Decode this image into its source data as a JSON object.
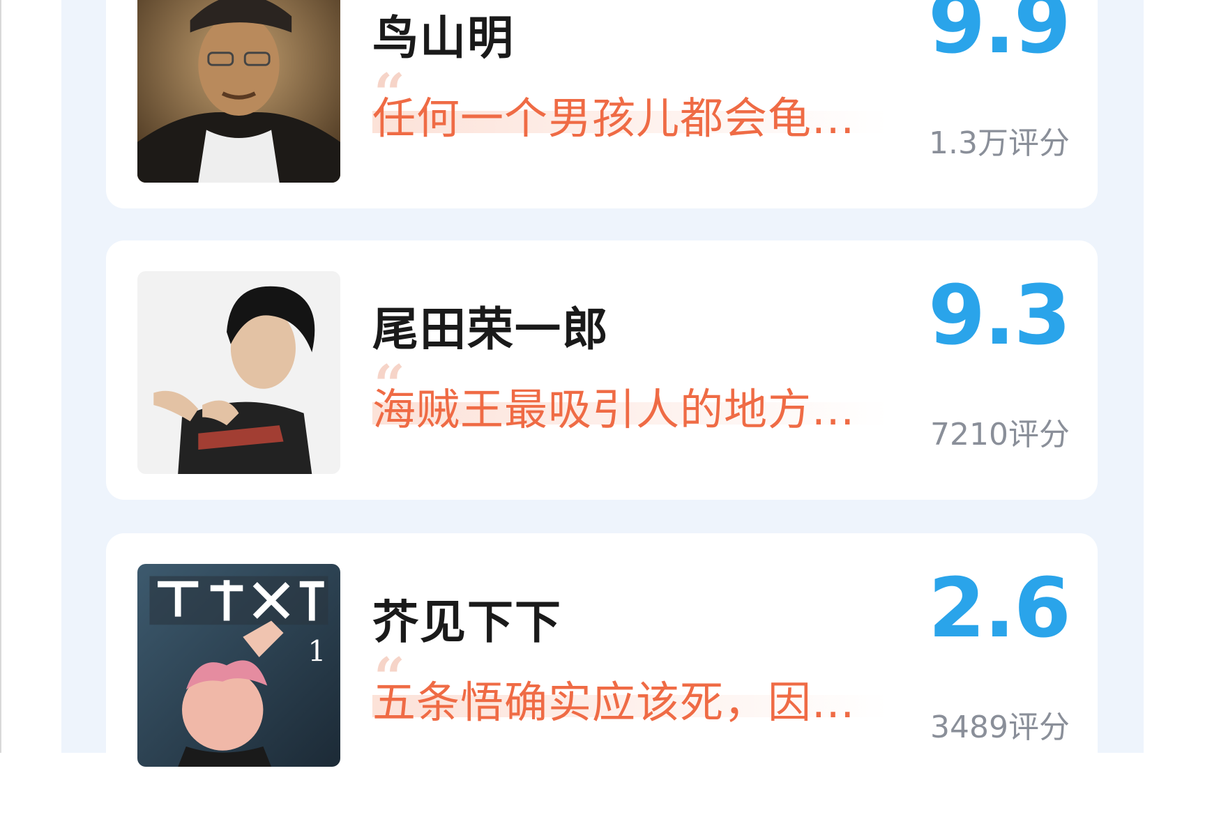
{
  "rankings": [
    {
      "name": "鸟山明",
      "comment": "任何一个男孩儿都会龟...",
      "score": "9.9",
      "rating_count": "1.3万评分",
      "image_icon": "portrait-photo-icon"
    },
    {
      "name": "尾田荣一郎",
      "comment": "海贼王最吸引人的地方...",
      "score": "9.3",
      "rating_count": "7210评分",
      "image_icon": "portrait-photo-icon"
    },
    {
      "name": "芥见下下",
      "comment": "五条悟确实应该死，因...",
      "score": "2.6",
      "rating_count": "3489评分",
      "image_icon": "manga-cover-icon"
    }
  ],
  "colors": {
    "score_blue": "#2aa4ea",
    "comment_orange": "#ef6b45",
    "panel_background": "#eef4fc"
  }
}
